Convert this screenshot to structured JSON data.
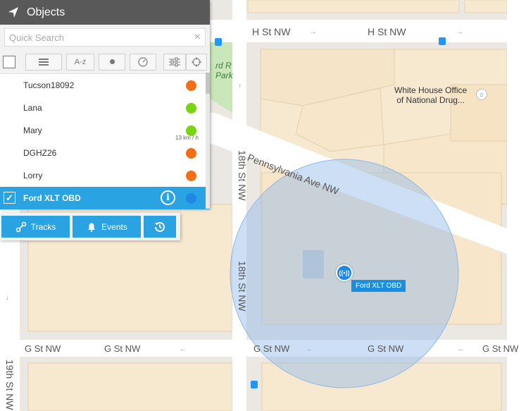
{
  "panel": {
    "title": "Objects",
    "search": {
      "placeholder": "Quick Search",
      "value": ""
    },
    "toolbar": {
      "sort_label": "A-z"
    },
    "objects": [
      {
        "name": "Tucson18092",
        "status_color": "#f26f16",
        "speed": ""
      },
      {
        "name": "Lana",
        "status_color": "#79d413",
        "speed": ""
      },
      {
        "name": "Mary",
        "status_color": "#79d413",
        "speed": "13 km / h"
      },
      {
        "name": "DGHZ26",
        "status_color": "#f26f16",
        "speed": ""
      },
      {
        "name": "Lorry",
        "status_color": "#f26f16",
        "speed": ""
      },
      {
        "name": "Ford XLT OBD",
        "status_color": "#1e88e5",
        "speed": "",
        "selected": true
      }
    ]
  },
  "actions": {
    "tracks_label": "Tracks",
    "events_label": "Events"
  },
  "map": {
    "streets": {
      "h_st_left": "H St NW",
      "h_st_right": "H St NW",
      "g_st_1": "G St NW",
      "g_st_2": "G St NW",
      "g_st_3": "G St NW",
      "g_st_4": "G St NW",
      "g_st_5": "G St NW",
      "pennsylvania": "Pennsylvania Ave NW",
      "st18_top": "18th St NW",
      "st18_bottom": "18th St NW",
      "st19": "19th St NW",
      "park_fragment_1": "rd R",
      "park_fragment_2": "Park"
    },
    "poi": {
      "line1": "White House Office",
      "line2": "of National Drug..."
    },
    "vehicle_label": "Ford XLT OBD",
    "accent": "#29a3e1"
  }
}
